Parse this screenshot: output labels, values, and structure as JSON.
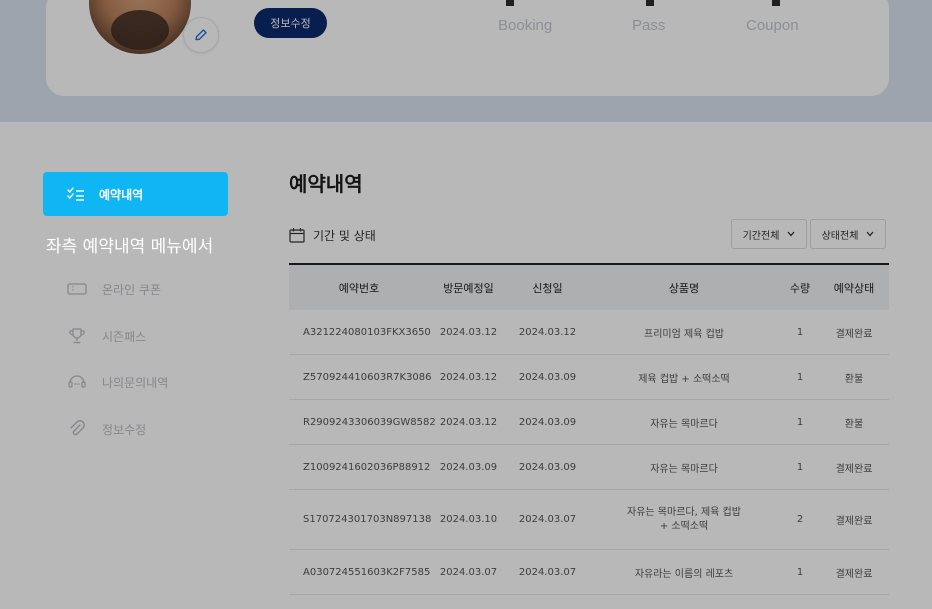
{
  "profile": {
    "edit_button": "정보수정",
    "stats": [
      {
        "label": "Booking"
      },
      {
        "label": "Pass"
      },
      {
        "label": "Coupon"
      }
    ]
  },
  "sidebar": {
    "active_item": {
      "label": "예약내역",
      "icon": "checklist-icon"
    },
    "callout": "좌측 예약내역 메뉴에서",
    "items": [
      {
        "label": "온라인 쿠폰",
        "icon": "ticket-icon"
      },
      {
        "label": "시즌패스",
        "icon": "trophy-icon"
      },
      {
        "label": "나의문의내역",
        "icon": "headset-icon"
      },
      {
        "label": "정보수정",
        "icon": "paperclip-icon"
      }
    ]
  },
  "main": {
    "title": "예약내역",
    "filter_label": "기간 및 상태",
    "period_select": "기간전체",
    "status_select": "상태전체"
  },
  "table": {
    "headers": [
      "예약번호",
      "방문예정일",
      "신청일",
      "상품명",
      "수량",
      "예약상태"
    ],
    "rows": [
      [
        "A321224080103FKX3650",
        "2024.03.12",
        "2024.03.12",
        "프리미엄 제육 컵밥",
        "1",
        "결제완료"
      ],
      [
        "Z570924410603R7K3086",
        "2024.03.12",
        "2024.03.09",
        "제육 컵밥 + 소떡소떡",
        "1",
        "환불"
      ],
      [
        "R2909243306039GW8582",
        "2024.03.12",
        "2024.03.09",
        "자유는 목마르다",
        "1",
        "환불"
      ],
      [
        "Z1009241602036P88912",
        "2024.03.09",
        "2024.03.09",
        "자유는 목마르다",
        "1",
        "결제완료"
      ],
      [
        "S170724301703N897138",
        "2024.03.10",
        "2024.03.07",
        "자유는 목마르다, 제육 컵밥 + 소떡소떡",
        "2",
        "결제완료"
      ],
      [
        "A030724551603K2F7585",
        "2024.03.07",
        "2024.03.07",
        "자유라는 이름의 레포츠",
        "1",
        "결제완료"
      ]
    ]
  },
  "colors": {
    "active_menu": "#10b6f3",
    "edit_button": "#0b2a6e",
    "band": "#dbe4f0"
  }
}
